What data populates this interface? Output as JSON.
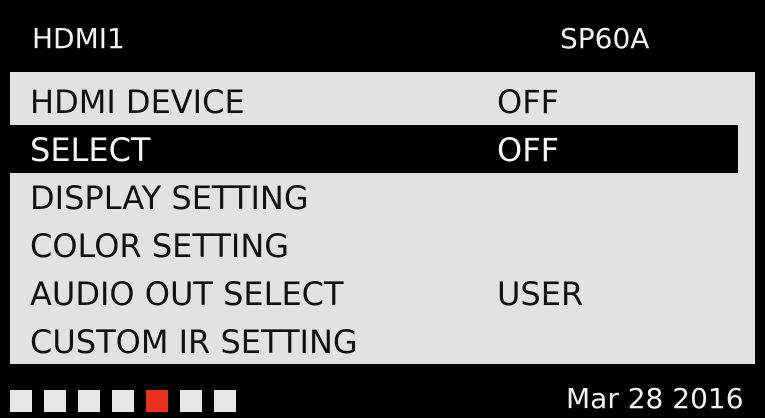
{
  "header": {
    "source": "HDMI1",
    "model": "SP60A"
  },
  "menu": {
    "items": [
      {
        "label": "HDMI DEVICE",
        "value": "OFF"
      },
      {
        "label": "SELECT",
        "value": "OFF"
      },
      {
        "label": "DISPLAY SETTING",
        "value": ""
      },
      {
        "label": "COLOR SETTING",
        "value": ""
      },
      {
        "label": "AUDIO OUT SELECT",
        "value": "USER"
      },
      {
        "label": "CUSTOM IR SETTING",
        "value": ""
      }
    ]
  },
  "footer": {
    "page_count": 7,
    "active_page": 5,
    "dot_color": "#e6e6e6",
    "active_dot_color": "#e8321f",
    "date": "Mar 28 2016"
  },
  "colors": {
    "background": "#000000",
    "menu_bg": "#e2e2e2",
    "selected_bg": "#000000"
  }
}
